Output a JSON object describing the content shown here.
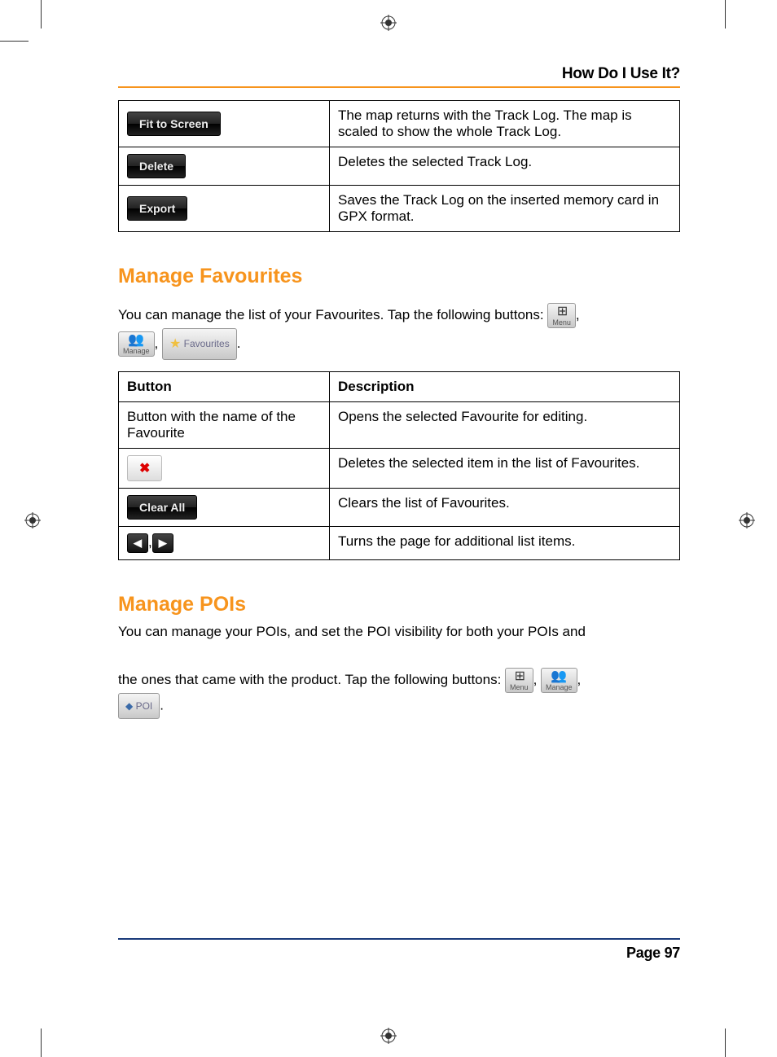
{
  "header": {
    "section_title": "How Do I Use It?"
  },
  "top_table": {
    "rows": [
      {
        "button_label": "Fit to Screen",
        "description": "The map returns with the Track Log. The map is scaled to show the whole Track Log."
      },
      {
        "button_label": "Delete",
        "description": "Deletes the selected Track Log."
      },
      {
        "button_label": "Export",
        "description": "Saves the Track Log on the inserted memory card in GPX format."
      }
    ]
  },
  "favourites": {
    "heading": "Manage Favourites",
    "intro": "You can manage the list of your Favourites. Tap the following buttons: ",
    "inline_buttons": {
      "menu": "Menu",
      "manage": "Manage",
      "favourites": "Favourites"
    },
    "table": {
      "col_button": "Button",
      "col_desc": "Description",
      "rows": [
        {
          "button_label": "Button with the name of the Favourite",
          "is_text": true,
          "description": "Opens the selected Favourite for editing."
        },
        {
          "button_label": "delete-x",
          "is_delete_icon": true,
          "description": "Deletes the selected item in the list of Favourites."
        },
        {
          "button_label": "Clear All",
          "is_dark": true,
          "description": "Clears the list of Favourites."
        },
        {
          "button_label": "arrows",
          "is_arrows": true,
          "description": "Turns the page for additional list items."
        }
      ]
    }
  },
  "pois": {
    "heading": "Manage POIs",
    "intro_1": "You can manage your POIs, and set the POI visibility for both your POIs and",
    "intro_2": "the ones that came with the product. Tap the following buttons: ",
    "inline_buttons": {
      "menu": "Menu",
      "manage": "Manage",
      "poi": "POI"
    }
  },
  "footer": {
    "page_number": "Page 97"
  }
}
